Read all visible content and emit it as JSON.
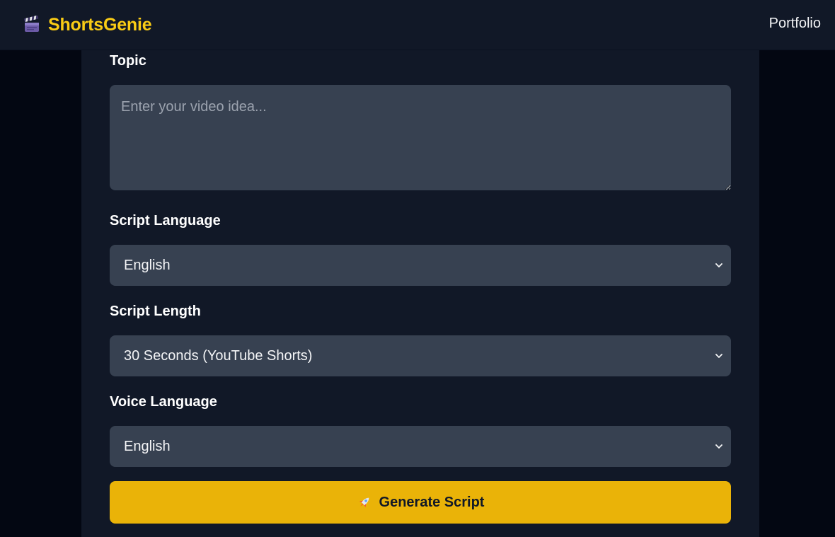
{
  "app": {
    "brand_name": "ShortsGenie",
    "brand_color": "#facc15",
    "brand_icon": "clapperboard-icon"
  },
  "nav": {
    "portfolio_label": "Portfolio"
  },
  "form": {
    "topic": {
      "label": "Topic",
      "value": "",
      "placeholder": "Enter your video idea..."
    },
    "script_language": {
      "label": "Script Language",
      "selected": "English",
      "icon": "chevron-down-icon"
    },
    "script_length": {
      "label": "Script Length",
      "selected": "30 Seconds (YouTube Shorts)",
      "icon": "chevron-down-icon"
    },
    "voice_language": {
      "label": "Voice Language",
      "selected": "English",
      "icon": "chevron-down-icon"
    },
    "generate_button": {
      "label": "Generate Script",
      "icon": "rocket-icon",
      "color": "#eab308"
    }
  }
}
